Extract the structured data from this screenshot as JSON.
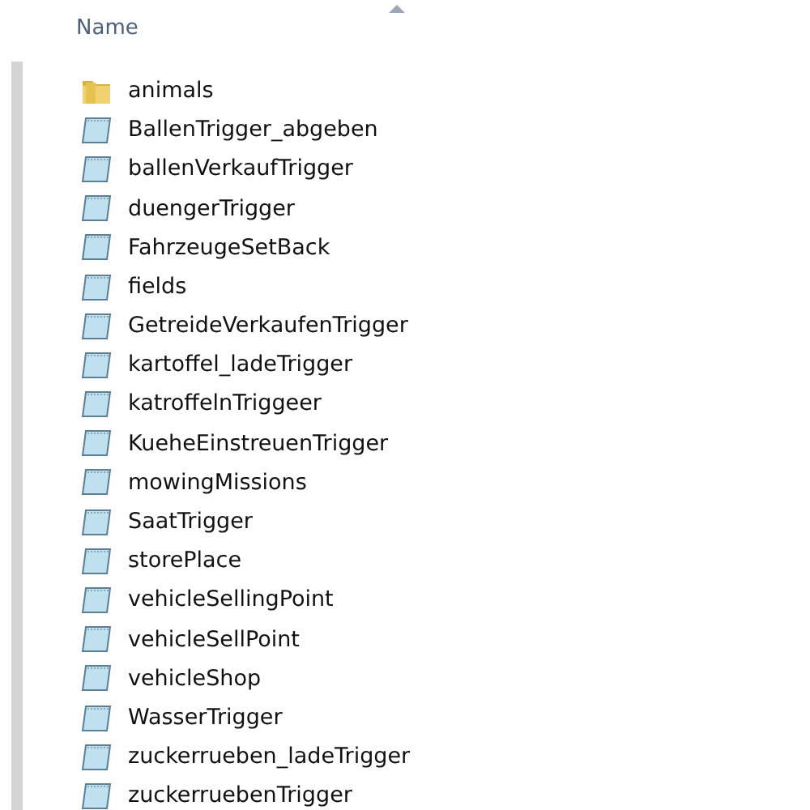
{
  "column_header": {
    "label": "Name",
    "sorted_ascending": true
  },
  "items": [
    {
      "name": "animals",
      "kind": "folder"
    },
    {
      "name": "BallenTrigger_abgeben",
      "kind": "file"
    },
    {
      "name": "ballenVerkaufTrigger",
      "kind": "file"
    },
    {
      "name": "duengerTrigger",
      "kind": "file"
    },
    {
      "name": "FahrzeugeSetBack",
      "kind": "file"
    },
    {
      "name": "fields",
      "kind": "file"
    },
    {
      "name": "GetreideVerkaufenTrigger",
      "kind": "file"
    },
    {
      "name": "kartoffel_ladeTrigger",
      "kind": "file"
    },
    {
      "name": "katroffelnTriggeer",
      "kind": "file"
    },
    {
      "name": "KueheEinstreuenTrigger",
      "kind": "file"
    },
    {
      "name": "mowingMissions",
      "kind": "file"
    },
    {
      "name": "SaatTrigger",
      "kind": "file"
    },
    {
      "name": "storePlace",
      "kind": "file"
    },
    {
      "name": "vehicleSellingPoint",
      "kind": "file"
    },
    {
      "name": "vehicleSellPoint",
      "kind": "file"
    },
    {
      "name": "vehicleShop",
      "kind": "file"
    },
    {
      "name": "WasserTrigger",
      "kind": "file"
    },
    {
      "name": "zuckerrueben_ladeTrigger",
      "kind": "file"
    },
    {
      "name": "zuckerruebenTrigger",
      "kind": "file"
    }
  ]
}
